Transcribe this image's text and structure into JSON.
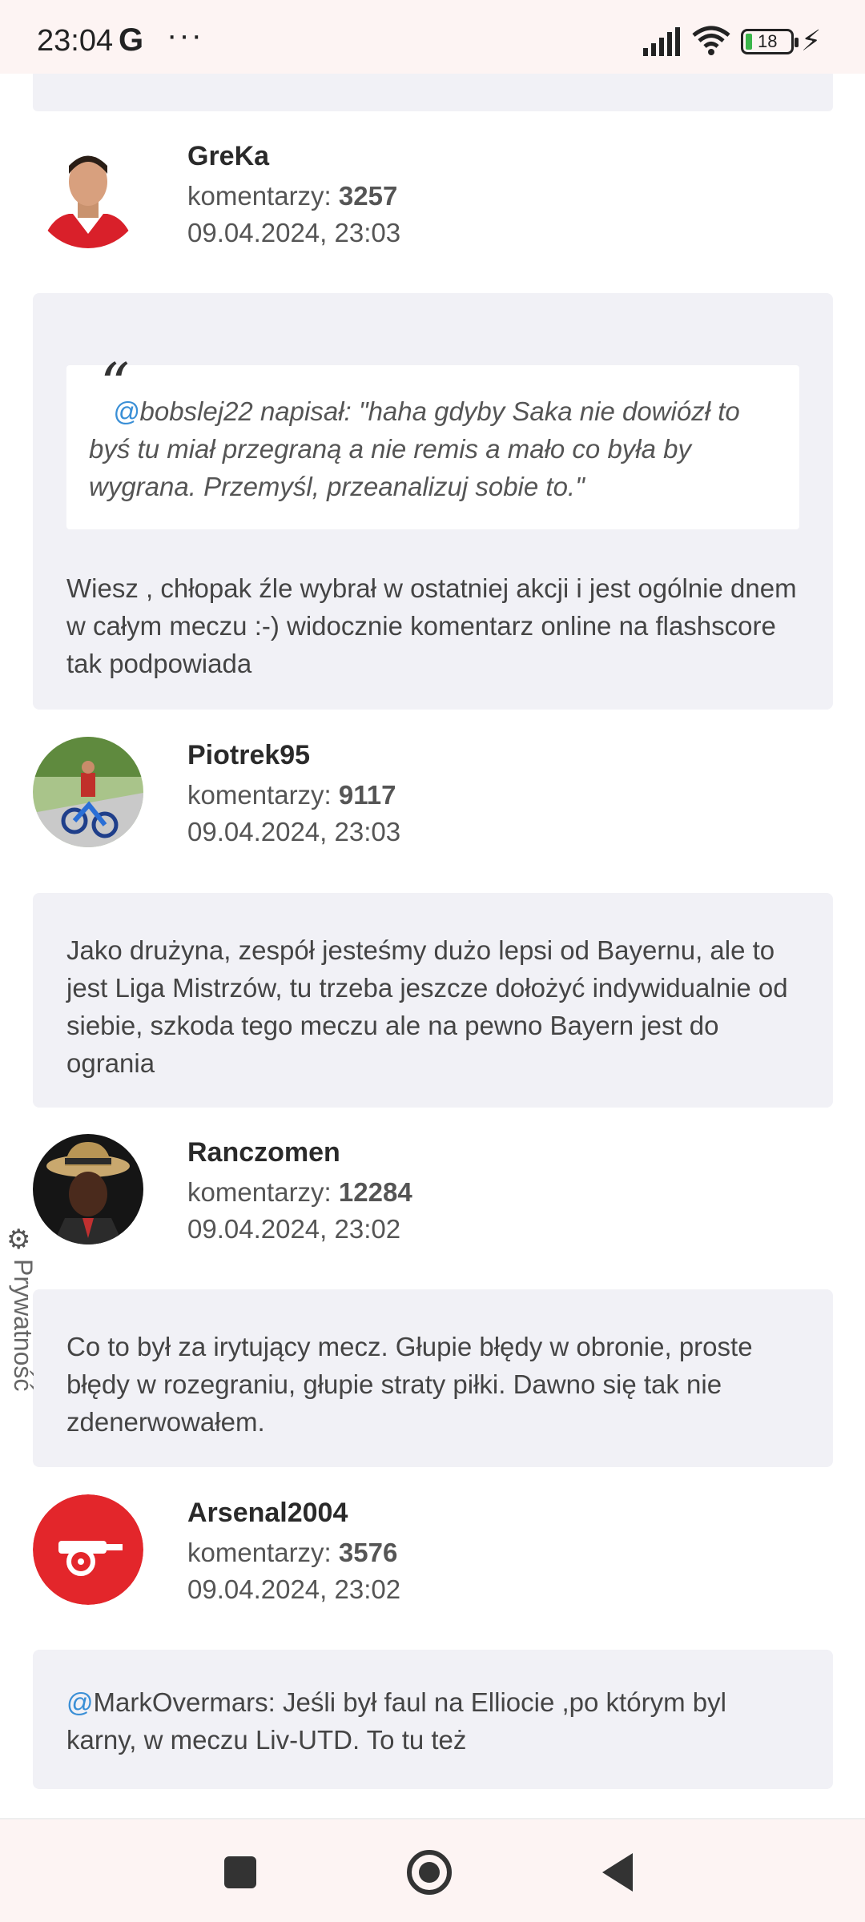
{
  "status_bar": {
    "time": "23:04",
    "carrier_icon": "G",
    "more": "···",
    "battery": "18"
  },
  "privacy_tab": {
    "label": "Prywatność"
  },
  "comments": [
    {
      "username": "GreKa",
      "count_label": "komentarzy:",
      "count": "3257",
      "date": "09.04.2024, 23:03",
      "quote_mention": "@",
      "quote": "bobslej22 napisał: \"haha gdyby Saka nie dowiózł to byś tu miał przegraną a nie remis a mało co była by wygrana. Przemyśl, przeanalizuj sobie to.\"",
      "body": "Wiesz , chłopak źle wybrał w ostatniej akcji i jest ogólnie dnem w całym meczu :-) widocznie komentarz online na flashscore tak podpowiada"
    },
    {
      "username": "Piotrek95",
      "count_label": "komentarzy:",
      "count": "9117",
      "date": "09.04.2024, 23:03",
      "body": "Jako drużyna, zespół jesteśmy dużo lepsi od Bayernu, ale to jest Liga Mistrzów, tu trzeba jeszcze dołożyć indywidualnie od siebie, szkoda tego meczu ale na pewno Bayern jest do ogrania"
    },
    {
      "username": "Ranczomen",
      "count_label": "komentarzy:",
      "count": "12284",
      "date": "09.04.2024, 23:02",
      "body": "Co to był za irytujący mecz. Głupie błędy w obronie, proste błędy w rozegraniu, głupie straty piłki. Dawno się tak nie zdenerwowałem."
    },
    {
      "username": "Arsenal2004",
      "count_label": "komentarzy:",
      "count": "3576",
      "date": "09.04.2024, 23:02",
      "body_mention": "@",
      "body": "MarkOvermars: Jeśli był faul na Elliocie ,po którym byl karny, w meczu Liv-UTD. To tu też"
    }
  ]
}
